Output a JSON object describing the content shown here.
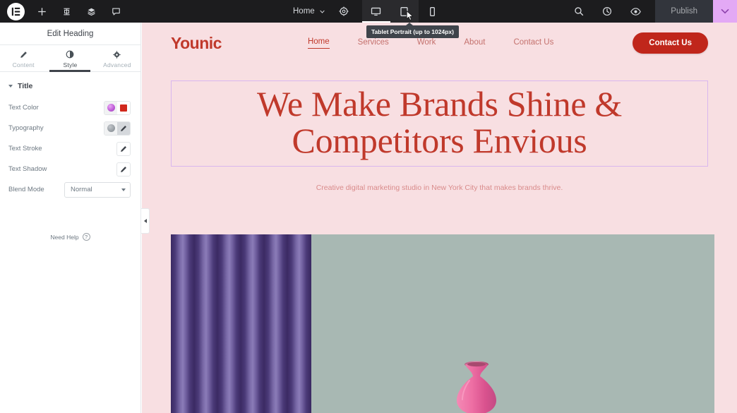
{
  "topbar": {
    "logo_icon": "elementor-logo-icon",
    "left_icons": [
      {
        "name": "add-element-icon",
        "glyph": "plus"
      },
      {
        "name": "site-settings-icon",
        "glyph": "structure"
      },
      {
        "name": "navigator-icon",
        "glyph": "layers"
      },
      {
        "name": "comments-icon",
        "glyph": "chat"
      }
    ],
    "page_selector": {
      "label": "Home",
      "caret": "chevron-down-icon"
    },
    "settings_icon": "gear-icon",
    "devices": [
      {
        "name": "desktop",
        "icon": "desktop-icon",
        "active": true,
        "hovered": false
      },
      {
        "name": "tablet",
        "icon": "tablet-icon",
        "active": false,
        "hovered": true
      },
      {
        "name": "mobile",
        "icon": "mobile-icon",
        "active": false,
        "hovered": false
      }
    ],
    "right_icons": [
      {
        "name": "search-icon",
        "glyph": "magnifier"
      },
      {
        "name": "history-icon",
        "glyph": "clock"
      },
      {
        "name": "preview-icon",
        "glyph": "eye"
      }
    ],
    "publish_label": "Publish",
    "right_strip_icon": "chevron-down-icon",
    "bg_color": "#1c1c1e",
    "accent_strip_color": "#e3a9f5"
  },
  "tooltip": {
    "text": "Tablet Portrait (up to 1024px)"
  },
  "panel": {
    "title": "Edit Heading",
    "tabs": [
      {
        "label": "Content",
        "icon": "pencil-icon",
        "active": false
      },
      {
        "label": "Style",
        "icon": "contrast-icon",
        "active": true
      },
      {
        "label": "Advanced",
        "icon": "gear-icon",
        "active": false
      }
    ],
    "section": {
      "label": "Title",
      "expanded": true
    },
    "controls": [
      {
        "label": "Text Color",
        "type": "color",
        "dynamic_icon": "dynamic-tags-globe-icon",
        "swatch_color": "#d0281c"
      },
      {
        "label": "Typography",
        "type": "typography",
        "global_icon": "global-fonts-globe-icon",
        "edit_icon": "pencil-icon"
      },
      {
        "label": "Text Stroke",
        "type": "popover",
        "edit_icon": "pencil-icon"
      },
      {
        "label": "Text Shadow",
        "type": "popover",
        "edit_icon": "pencil-icon"
      },
      {
        "label": "Blend Mode",
        "type": "select",
        "value": "Normal",
        "caret": "chevron-down-icon"
      }
    ],
    "need_help": {
      "label": "Need Help",
      "icon": "question-circle-icon"
    },
    "collapse_handle": "panel-collapse-icon"
  },
  "canvas": {
    "background_color": "#f8dfe2",
    "site": {
      "logo": "Younic",
      "logo_color": "#c0392b",
      "nav": [
        {
          "label": "Home",
          "active": true
        },
        {
          "label": "Services",
          "active": false
        },
        {
          "label": "Work",
          "active": false
        },
        {
          "label": "About",
          "active": false
        },
        {
          "label": "Contact Us",
          "active": false
        }
      ],
      "cta": {
        "label": "Contact Us",
        "bg_color": "#c0261b",
        "text_color": "#ffffff"
      },
      "hero": {
        "heading_line1": "We Make Brands Shine &",
        "heading_line2": "Competitors Envious",
        "heading_color": "#c0392b",
        "selection_border_color": "#d9b6ee",
        "subtitle": "Creative digital marketing studio in New York City that makes brands thrive."
      },
      "photo": {
        "name": "interior-photo",
        "curtain_color": "#4b3a78",
        "wall_color": "#a8b8b3",
        "vase_color": "#e8649b"
      }
    }
  }
}
